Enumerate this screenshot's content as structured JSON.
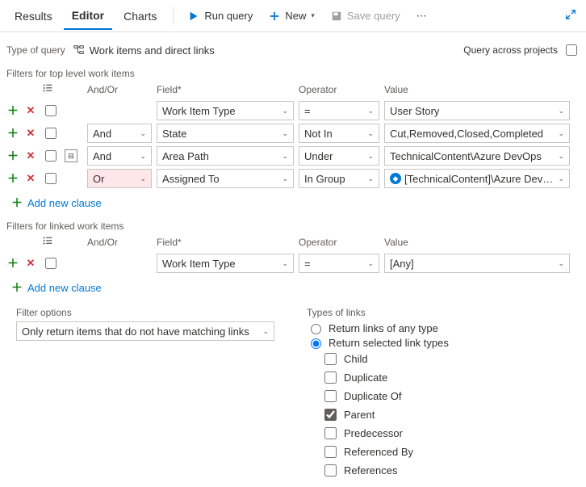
{
  "tabs": {
    "results": "Results",
    "editor": "Editor",
    "charts": "Charts"
  },
  "toolbar": {
    "run": "Run query",
    "new": "New",
    "save": "Save query"
  },
  "query_type": {
    "label": "Type of query",
    "value": "Work items and direct links"
  },
  "query_across": {
    "label": "Query across projects"
  },
  "top": {
    "title": "Filters for top level work items",
    "headers": {
      "andor": "And/Or",
      "field": "Field*",
      "operator": "Operator",
      "value": "Value"
    },
    "rows": [
      {
        "andor": "",
        "field": "Work Item Type",
        "op": "=",
        "value": "User Story",
        "logo": false,
        "tree": false,
        "invalid": false
      },
      {
        "andor": "And",
        "field": "State",
        "op": "Not In",
        "value": "Cut,Removed,Closed,Completed",
        "logo": false,
        "tree": false,
        "invalid": false
      },
      {
        "andor": "And",
        "field": "Area Path",
        "op": "Under",
        "value": "TechnicalContent\\Azure DevOps",
        "logo": false,
        "tree": true,
        "invalid": false
      },
      {
        "andor": "Or",
        "field": "Assigned To",
        "op": "In Group",
        "value": "[TechnicalContent]\\Azure DevOps",
        "logo": true,
        "tree": false,
        "invalid": true
      }
    ],
    "add": "Add new clause"
  },
  "linked": {
    "title": "Filters for linked work items",
    "rows": [
      {
        "andor": "",
        "field": "Work Item Type",
        "op": "=",
        "value": "[Any]"
      }
    ],
    "add": "Add new clause"
  },
  "filter_options": {
    "label": "Filter options",
    "value": "Only return items that do not have matching links"
  },
  "link_types": {
    "label": "Types of links",
    "r1": "Return links of any type",
    "r2": "Return selected link types",
    "items": [
      {
        "label": "Child",
        "checked": false
      },
      {
        "label": "Duplicate",
        "checked": false
      },
      {
        "label": "Duplicate Of",
        "checked": false
      },
      {
        "label": "Parent",
        "checked": true
      },
      {
        "label": "Predecessor",
        "checked": false
      },
      {
        "label": "Referenced By",
        "checked": false
      },
      {
        "label": "References",
        "checked": false
      }
    ]
  }
}
